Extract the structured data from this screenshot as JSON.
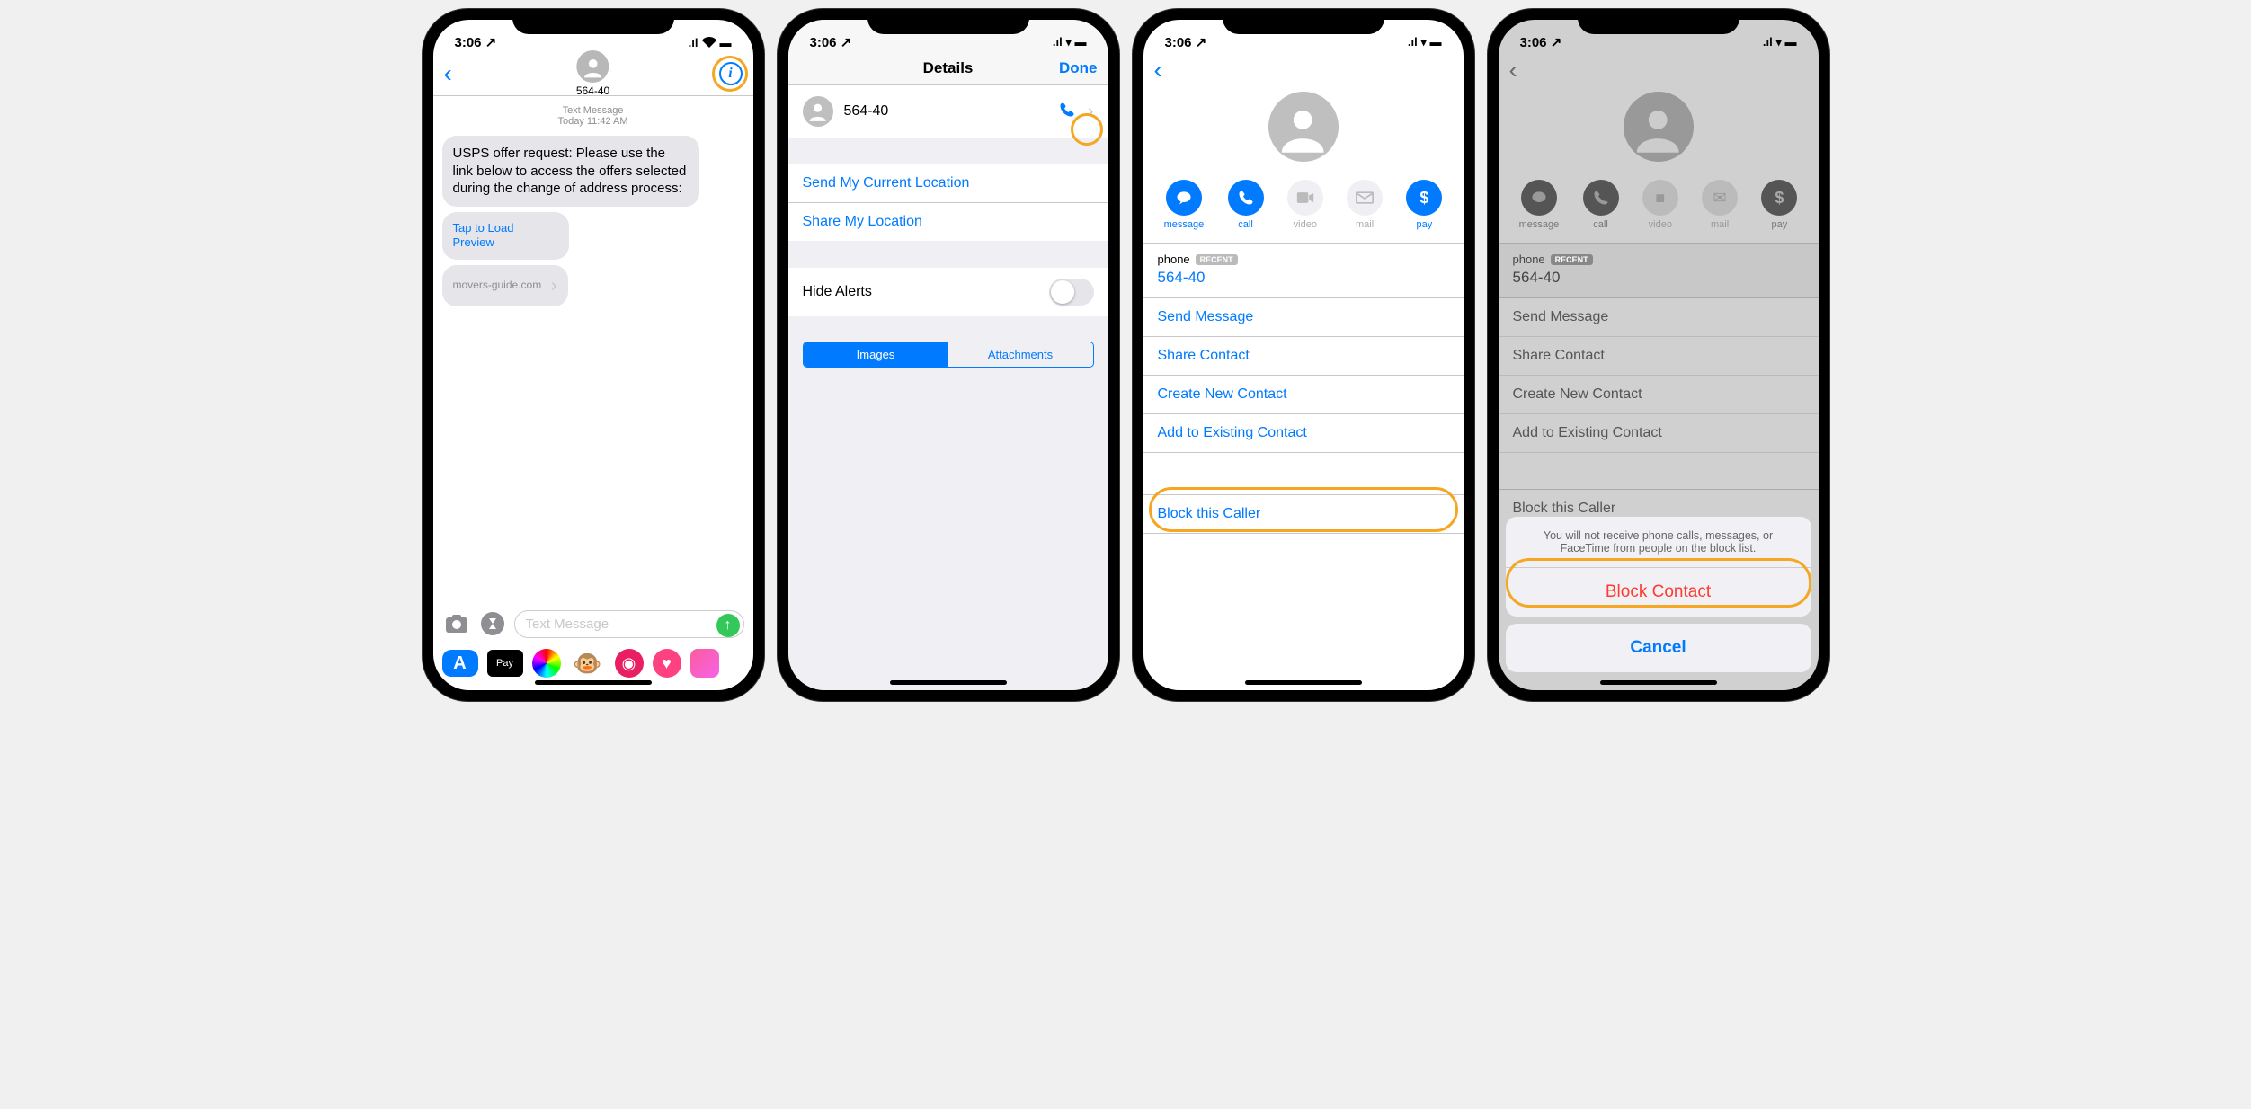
{
  "status": {
    "time": "3:06",
    "loc": "↗",
    "signal": "••ıl",
    "wifi": "▾",
    "battery": "▭"
  },
  "s1": {
    "phone": "564-40",
    "meta_type": "Text Message",
    "meta_date": "Today 11:42 AM",
    "msg": "USPS offer request: Please use the link below to access the offers selected during the change of address process:",
    "preview": "Tap to Load Preview",
    "domain": "movers-guide.com",
    "placeholder": "Text Message",
    "pay": "Pay"
  },
  "s2": {
    "title": "Details",
    "done": "Done",
    "contact": "564-40",
    "send_loc": "Send My Current Location",
    "share_loc": "Share My Location",
    "hide_alerts": "Hide Alerts",
    "seg_images": "Images",
    "seg_attach": "Attachments"
  },
  "s3": {
    "phone_label": "phone",
    "recent": "RECENT",
    "phone_num": "564-40",
    "actions": {
      "message": "message",
      "call": "call",
      "video": "video",
      "mail": "mail",
      "pay": "pay"
    },
    "send_msg": "Send Message",
    "share": "Share Contact",
    "create": "Create New Contact",
    "add_existing": "Add to Existing Contact",
    "block": "Block this Caller"
  },
  "s4": {
    "sheet_msg": "You will not receive phone calls, messages, or FaceTime from people on the block list.",
    "block": "Block Contact",
    "cancel": "Cancel"
  }
}
